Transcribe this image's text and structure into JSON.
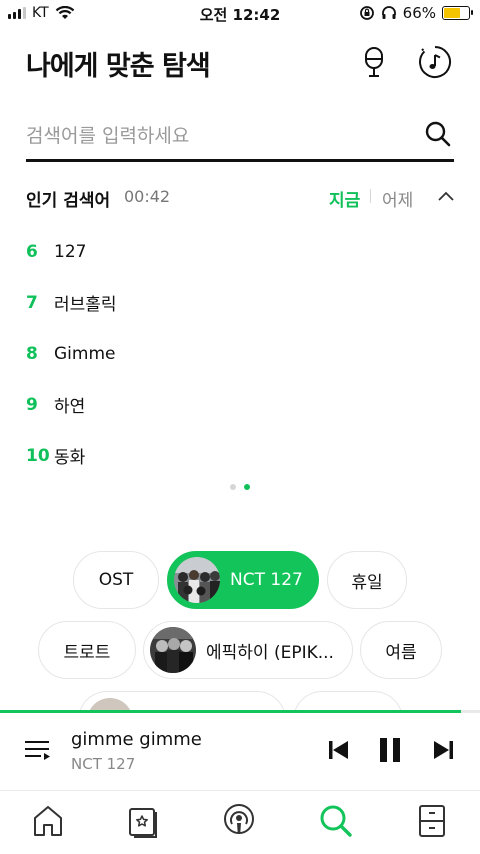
{
  "status_bar": {
    "carrier": "KT",
    "time": "오전 12:42",
    "battery": "66%",
    "battery_level": 0.66,
    "battery_color": "#f5c400"
  },
  "header": {
    "title": "나에게 맞춘 탐색",
    "icons": [
      "microphone-icon",
      "music-recognition-icon"
    ]
  },
  "search": {
    "placeholder": "검색어를 입력하세요",
    "value": "",
    "icon": "search-icon"
  },
  "popular": {
    "title": "인기 검색어",
    "time": "00:42",
    "tabs": {
      "now": "지금",
      "yesterday": "어제"
    },
    "items": [
      {
        "rank": "6",
        "text": "127"
      },
      {
        "rank": "7",
        "text": "러브홀릭"
      },
      {
        "rank": "8",
        "text": "Gimme"
      },
      {
        "rank": "9",
        "text": "하연"
      },
      {
        "rank": "10",
        "text": "동화"
      }
    ],
    "page_count": 2,
    "current_page": 2
  },
  "chips": {
    "row1": [
      "OST",
      "NCT 127",
      "휴일"
    ],
    "row2": [
      "트로트",
      "에픽하이 (EPIK...",
      "여름"
    ]
  },
  "player": {
    "title": "gimme gimme",
    "artist": "NCT 127",
    "progress": 0.96
  },
  "tabbar": {
    "tabs": [
      "home-icon",
      "storage-icon",
      "podcast-icon",
      "search-icon",
      "library-icon"
    ],
    "active": "search-icon"
  },
  "colors": {
    "accent": "#13c45a",
    "text": "#111111",
    "muted": "#888888"
  }
}
